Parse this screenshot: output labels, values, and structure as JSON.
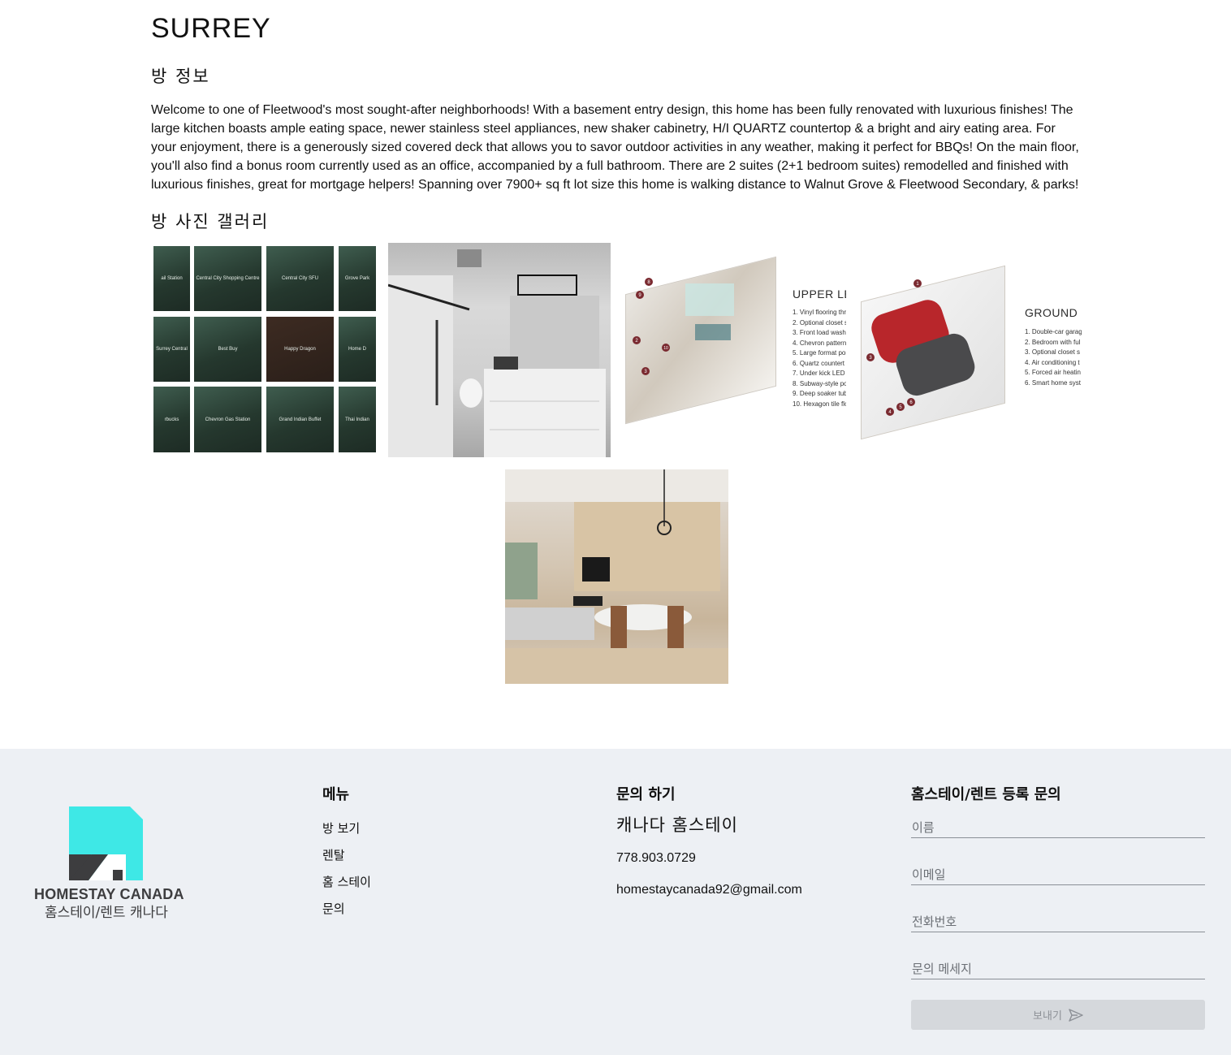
{
  "page": {
    "title": "SURREY",
    "info_heading": "방 정보",
    "description": "Welcome to one of Fleetwood's most sought-after neighborhoods! With a basement entry design, this home has been fully renovated with luxurious finishes! The large kitchen boasts ample eating space, newer stainless steel appliances, new shaker cabinetry, H/I QUARTZ countertop & a bright and airy eating area. For your enjoyment, there is a generously sized covered deck that allows you to savor outdoor activities in any weather, making it perfect for BBQs! On the main floor, you'll also find a bonus room currently used as an office, accompanied by a full bathroom. There are 2 suites (2+1 bedroom suites) remodelled and finished with luxurious finishes, great for mortgage helpers! Spanning over 7900+ sq ft lot size this home is walking distance to Walnut Grove & Fleetwood Secondary, & parks!",
    "gallery_heading": "방 사진 갤러리"
  },
  "gallery": {
    "map_tiles": [
      "ail Station",
      "Central City Shopping Centre",
      "Central City SFU",
      "Grove Park",
      "Surrey Central",
      "Best Buy",
      "Happy Dragon",
      "Home D",
      "rbucks",
      "Chevron Gas Station",
      "Grand Indian Buffet",
      "Thai Indian"
    ],
    "upper_title": "UPPER LE",
    "upper_list": [
      "1. Vinyl flooring thr",
      "2. Optional closet s",
      "3. Front load washe",
      "4. Chevron pattern",
      "5. Large format por",
      "6. Quartz countert",
      "7. Under kick LED l",
      "8. Subway-style po",
      "9. Deep soaker tub",
      "10. Hexagon tile flo"
    ],
    "upper_markers": [
      "8",
      "9",
      "2",
      "10",
      "3"
    ],
    "ground_title": "GROUND L",
    "ground_list": [
      "1. Double-car garag",
      "2. Bedroom with ful",
      "3. Optional closet s",
      "4. Air conditioning t",
      "5. Forced air heatin",
      "6. Smart home syst"
    ],
    "ground_markers": [
      "1",
      "3",
      "4",
      "5",
      "6"
    ]
  },
  "footer": {
    "logo_name": "HOMESTAY CANADA",
    "logo_sub": "홈스테이/렌트 캐나다",
    "menu_title": "메뉴",
    "menu_items": [
      "방 보기",
      "렌탈",
      "홈 스테이",
      "문의"
    ],
    "contact_title": "문의 하기",
    "contact_name": "캐나다 홈스테이",
    "phone": "778.903.0729",
    "email": "homestaycanada92@gmail.com",
    "form_title": "홈스테이/렌트 등록 문의",
    "form": {
      "name_placeholder": "이름",
      "email_placeholder": "이메일",
      "phone_placeholder": "전화번호",
      "message_placeholder": "문의 메세지",
      "submit_label": "보내기"
    }
  },
  "colors": {
    "logo_cyan": "#3ee8e6",
    "logo_dark": "#3d3d3f",
    "footer_bg": "#edf0f4",
    "marker": "#7a2a30"
  }
}
